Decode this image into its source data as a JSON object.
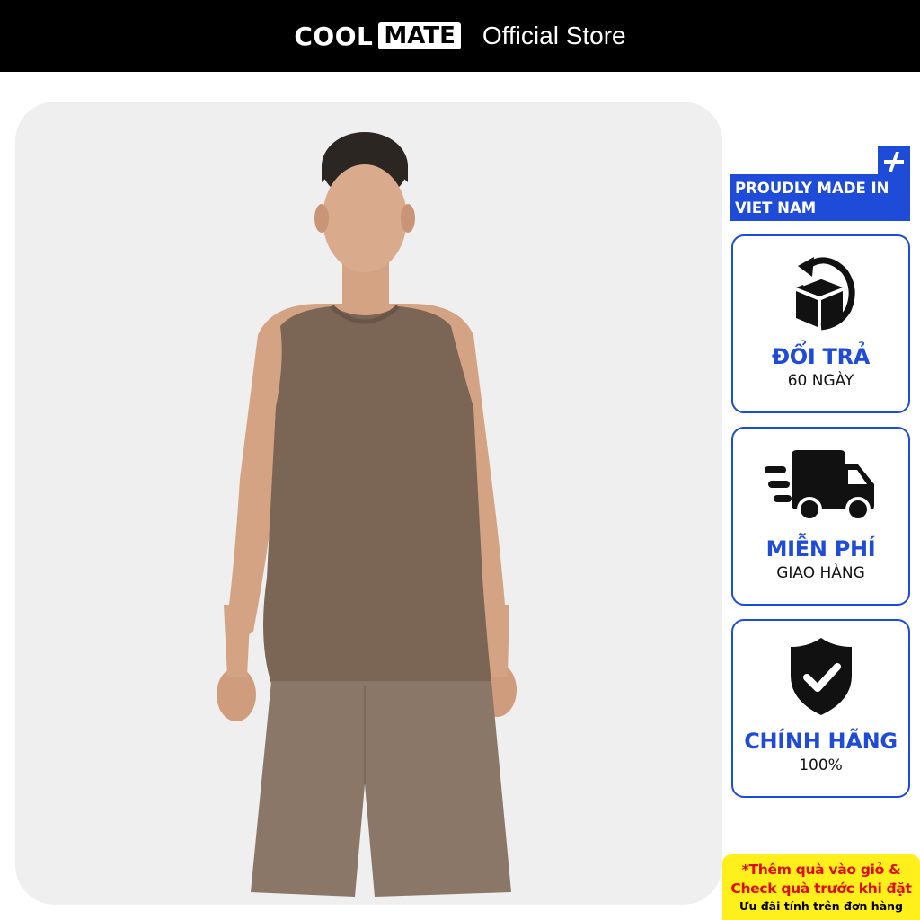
{
  "header": {
    "brand_cool": "COOL",
    "brand_mate": "MATE",
    "store_label": "Official Store"
  },
  "product": {
    "image_icon": "model-wearing-brown-tank-top-and-shorts",
    "shirt_color": "#7b6656",
    "shorts_color": "#8a7767",
    "background_color": "#efefef"
  },
  "badges": {
    "made_in": "PROUDLY MADE IN VIET NAM",
    "made_in_icon": "plus-slash-icon"
  },
  "features": [
    {
      "icon": "return-box-icon",
      "title": "ĐỔI TRẢ",
      "subtitle": "60 NGÀY"
    },
    {
      "icon": "delivery-truck-icon",
      "title": "MIỄN PHÍ",
      "subtitle": "GIAO HÀNG"
    },
    {
      "icon": "shield-check-icon",
      "title": "CHÍNH HÃNG",
      "subtitle": "100%"
    }
  ],
  "promo": {
    "line1": "*Thêm quà vào giỏ &",
    "line2": "Check quà trước khi đặt",
    "line3": "Ưu đãi tính trên đơn hàng"
  },
  "colors": {
    "accent": "#1e4bd8",
    "promo_bg": "#ffef1a",
    "promo_text": "#e00b0b"
  }
}
